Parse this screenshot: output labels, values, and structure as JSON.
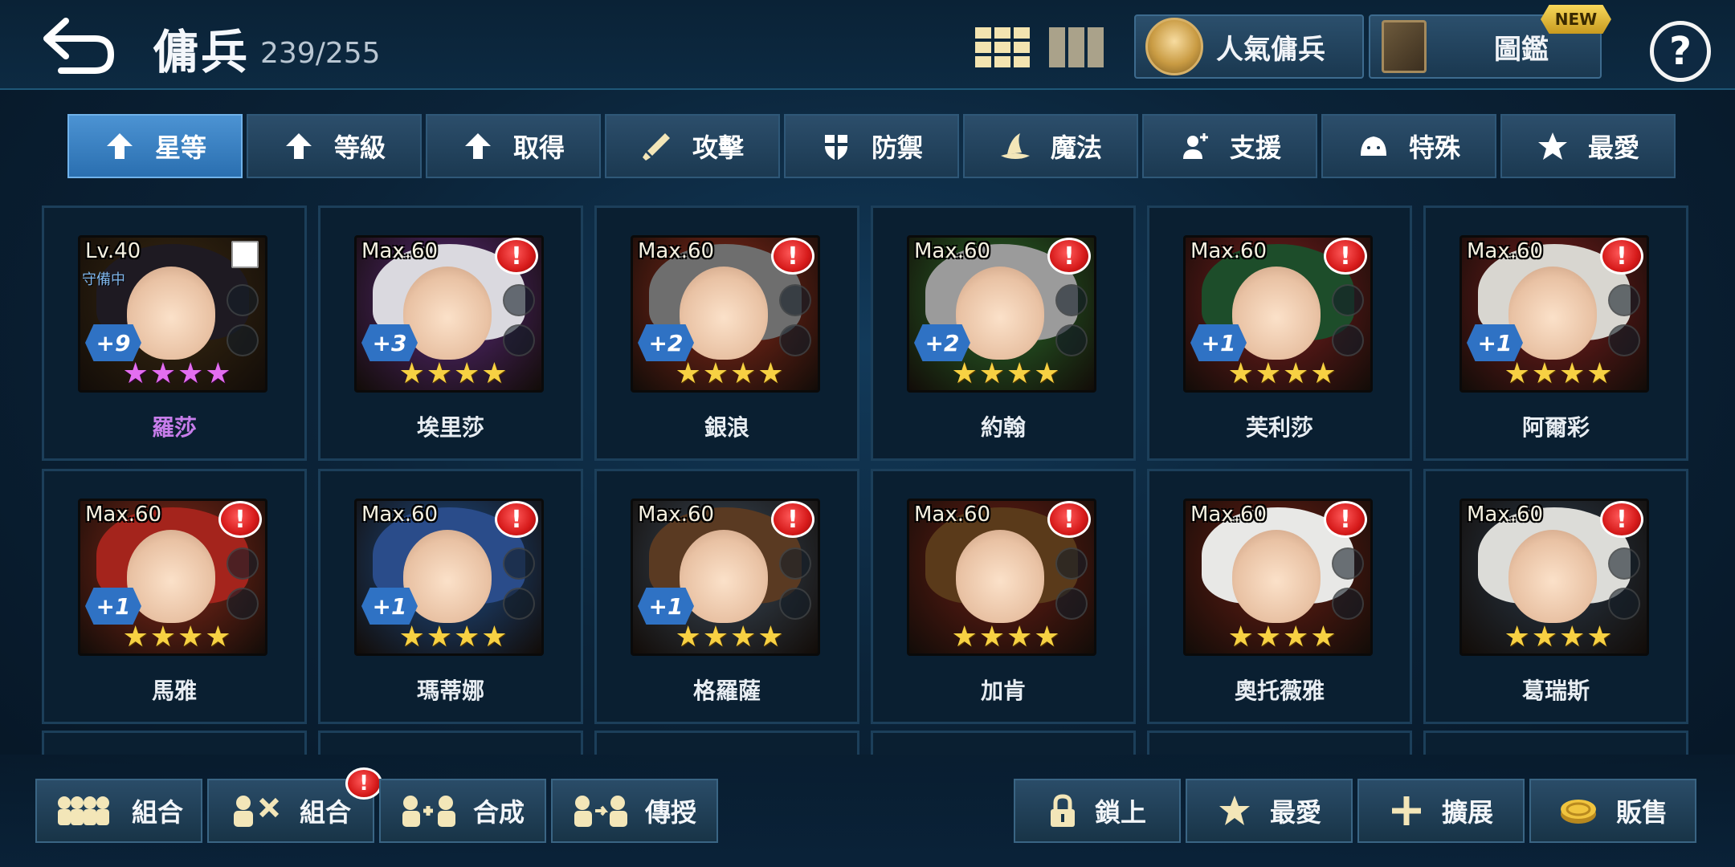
{
  "header": {
    "title": "傭兵",
    "count": "239/255",
    "popular_label": "人氣傭兵",
    "book_label": "圖鑑",
    "new_badge": "NEW",
    "help": "?"
  },
  "tabs": [
    {
      "label": "星等",
      "icon": "up-arrow-icon",
      "active": true
    },
    {
      "label": "等級",
      "icon": "up-arrow-icon"
    },
    {
      "label": "取得",
      "icon": "up-arrow-icon"
    },
    {
      "label": "攻擊",
      "icon": "sword-icon"
    },
    {
      "label": "防禦",
      "icon": "shield-icon"
    },
    {
      "label": "魔法",
      "icon": "wizard-hat-icon"
    },
    {
      "label": "支援",
      "icon": "support-icon"
    },
    {
      "label": "特殊",
      "icon": "slime-icon"
    },
    {
      "label": "最愛",
      "icon": "star-icon"
    }
  ],
  "heroes": [
    {
      "name": "羅莎",
      "level": "Lv.40",
      "status": "守備中",
      "plus": "+9",
      "stars": 4,
      "star_color": "purple",
      "alert": false,
      "hair": "#1e1a22",
      "bg": "#3a2a12"
    },
    {
      "name": "埃里莎",
      "level": "Max.60",
      "plus": "+3",
      "stars": 4,
      "alert": true,
      "alert_text": "!",
      "hair": "#dad9df",
      "bg": "#5a2a7a"
    },
    {
      "name": "銀浪",
      "level": "Max.60",
      "plus": "+2",
      "stars": 4,
      "alert": true,
      "alert_text": "!",
      "hair": "#6e6e6e",
      "bg": "#8a2a1a"
    },
    {
      "name": "約翰",
      "level": "Max.60",
      "plus": "+2",
      "stars": 4,
      "alert": true,
      "alert_text": "!",
      "hair": "#9b9b9b",
      "bg": "#2a6a2a"
    },
    {
      "name": "芙利莎",
      "level": "Max.60",
      "plus": "+1",
      "stars": 4,
      "alert": true,
      "alert_text": "!",
      "hair": "#1d4d2a",
      "bg": "#7a1e1e"
    },
    {
      "name": "阿爾彩",
      "level": "Max.60",
      "plus": "+1",
      "stars": 4,
      "alert": true,
      "alert_text": "!",
      "hair": "#d8d6d0",
      "bg": "#7a1e1e"
    },
    {
      "name": "馬雅",
      "level": "Max.60",
      "plus": "+1",
      "stars": 4,
      "alert": true,
      "alert_text": "!",
      "hair": "#a4241c",
      "bg": "#8a2a1a"
    },
    {
      "name": "瑪蒂娜",
      "level": "Max.60",
      "plus": "+1",
      "stars": 4,
      "alert": true,
      "alert_text": "!",
      "hair": "#2a4c8a",
      "bg": "#1e4e8a"
    },
    {
      "name": "格羅薩",
      "level": "Max.60",
      "plus": "+1",
      "stars": 4,
      "alert": true,
      "alert_text": "!",
      "hair": "#5a3a22",
      "bg": "#3a4a5a"
    },
    {
      "name": "加肯",
      "level": "Max.60",
      "plus": "",
      "stars": 4,
      "alert": true,
      "alert_text": "!",
      "hair": "#5a3a1a",
      "bg": "#6a1e14"
    },
    {
      "name": "奧托薇雅",
      "level": "Max.60",
      "plus": "",
      "stars": 4,
      "alert": true,
      "alert_text": "!",
      "hair": "#e8e8e6",
      "bg": "#6a1e14"
    },
    {
      "name": "葛瑞斯",
      "level": "Max.60",
      "plus": "",
      "stars": 4,
      "alert": true,
      "alert_text": "!",
      "hair": "#dcdcd8",
      "bg": "#2a3a4a"
    }
  ],
  "bottom": {
    "combo1": "組合",
    "combo2": "組合",
    "combo2_alert": "!",
    "fuse": "合成",
    "transfer": "傳授",
    "lock": "鎖上",
    "favorite": "最愛",
    "expand": "擴展",
    "sell": "販售"
  }
}
